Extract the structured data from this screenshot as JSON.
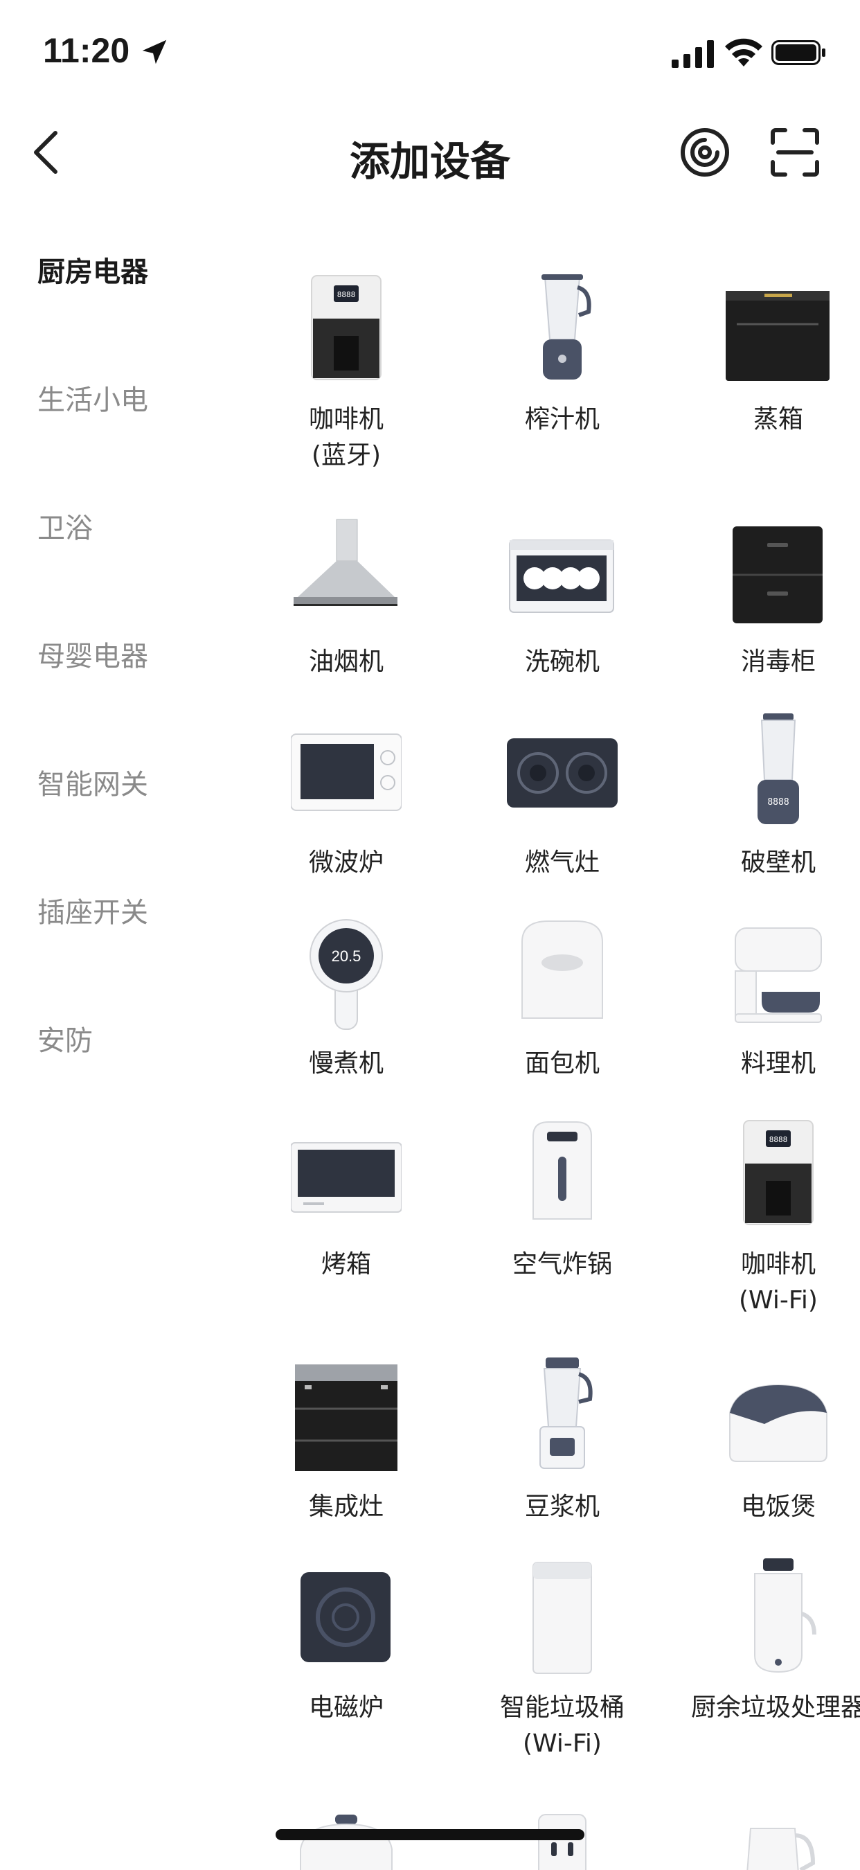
{
  "status_bar": {
    "time": "11:20"
  },
  "nav": {
    "title": "添加设备"
  },
  "colors": {
    "active_text": "#1a1a1a",
    "inactive_text": "#8a8a8a",
    "appliance_dark": "#2f3440",
    "appliance_slate": "#4a5266"
  },
  "sidebar": {
    "items": [
      {
        "label": "厨房电器",
        "active": true
      },
      {
        "label": "生活小电",
        "active": false
      },
      {
        "label": "卫浴",
        "active": false
      },
      {
        "label": "母婴电器",
        "active": false
      },
      {
        "label": "智能网关",
        "active": false
      },
      {
        "label": "插座开关",
        "active": false
      },
      {
        "label": "安防",
        "active": false
      }
    ]
  },
  "devices": [
    {
      "label": "咖啡机\n(蓝牙)",
      "icon": "coffee-machine-icon",
      "readout": "8888"
    },
    {
      "label": "榨汁机",
      "icon": "juicer-icon"
    },
    {
      "label": "蒸箱",
      "icon": "steam-oven-icon"
    },
    {
      "label": "油烟机",
      "icon": "range-hood-icon"
    },
    {
      "label": "洗碗机",
      "icon": "dishwasher-icon"
    },
    {
      "label": "消毒柜",
      "icon": "disinfection-cabinet-icon"
    },
    {
      "label": "微波炉",
      "icon": "microwave-icon"
    },
    {
      "label": "燃气灶",
      "icon": "gas-stove-icon"
    },
    {
      "label": "破壁机",
      "icon": "high-speed-blender-icon",
      "readout": "8888"
    },
    {
      "label": "慢煮机",
      "icon": "sous-vide-icon",
      "readout": "20.5"
    },
    {
      "label": "面包机",
      "icon": "bread-maker-icon"
    },
    {
      "label": "料理机",
      "icon": "food-processor-icon"
    },
    {
      "label": "烤箱",
      "icon": "oven-icon"
    },
    {
      "label": "空气炸锅",
      "icon": "air-fryer-icon"
    },
    {
      "label": "咖啡机\n(Wi-Fi)",
      "icon": "coffee-machine-wifi-icon",
      "readout": "8888"
    },
    {
      "label": "集成灶",
      "icon": "integrated-stove-icon"
    },
    {
      "label": "豆浆机",
      "icon": "soymilk-maker-icon"
    },
    {
      "label": "电饭煲",
      "icon": "rice-cooker-icon"
    },
    {
      "label": "电磁炉",
      "icon": "induction-cooker-icon"
    },
    {
      "label": "智能垃圾桶\n(Wi-Fi)",
      "icon": "smart-trash-can-icon"
    },
    {
      "label": "厨余垃圾处理器",
      "icon": "food-waste-disposer-icon"
    }
  ]
}
